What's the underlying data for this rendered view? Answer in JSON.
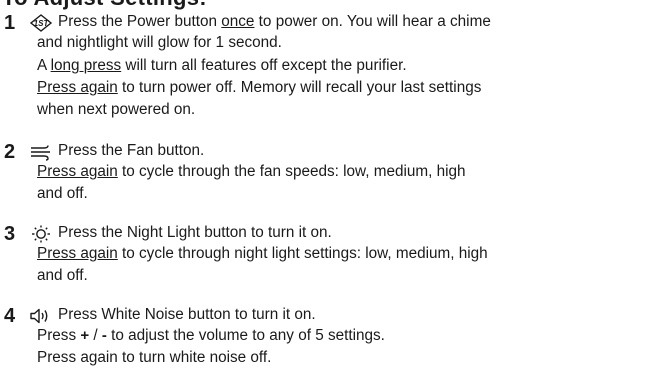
{
  "heading": "To Adjust Settings:",
  "steps": [
    {
      "number": "1",
      "icon": "power-1st-icon",
      "lines": [
        {
          "a": "Press the Power button ",
          "u": "once",
          "b": " to power on. You will hear a chime"
        },
        {
          "a": "and nightlight will glow for 1 second."
        },
        {
          "a": "A ",
          "u": "long press",
          "b": " will turn all features off except the purifier."
        },
        {
          "u": "Press again",
          "b": " to turn power off. Memory will recall your last settings"
        },
        {
          "a": "when next powered on."
        }
      ]
    },
    {
      "number": "2",
      "icon": "fan-icon",
      "lines": [
        {
          "a": "Press the Fan button."
        },
        {
          "u": "Press again",
          "b": " to cycle through the fan speeds: low, medium, high"
        },
        {
          "a": "and off."
        }
      ]
    },
    {
      "number": "3",
      "icon": "night-light-icon",
      "lines": [
        {
          "a": "Press the Night Light button to turn it on."
        },
        {
          "u": "Press again",
          "b": " to cycle through night light settings: low, medium, high"
        },
        {
          "a": "and off."
        }
      ]
    },
    {
      "number": "4",
      "icon": "speaker-icon",
      "lines": [
        {
          "a": "Press White Noise button to turn it on."
        },
        {
          "a": "Press ",
          "plus": "+",
          "slash": " / ",
          "minus": "-",
          "b": " to adjust the volume to any of 5 settings."
        },
        {
          "a": "Press again to turn white noise off."
        }
      ]
    }
  ]
}
